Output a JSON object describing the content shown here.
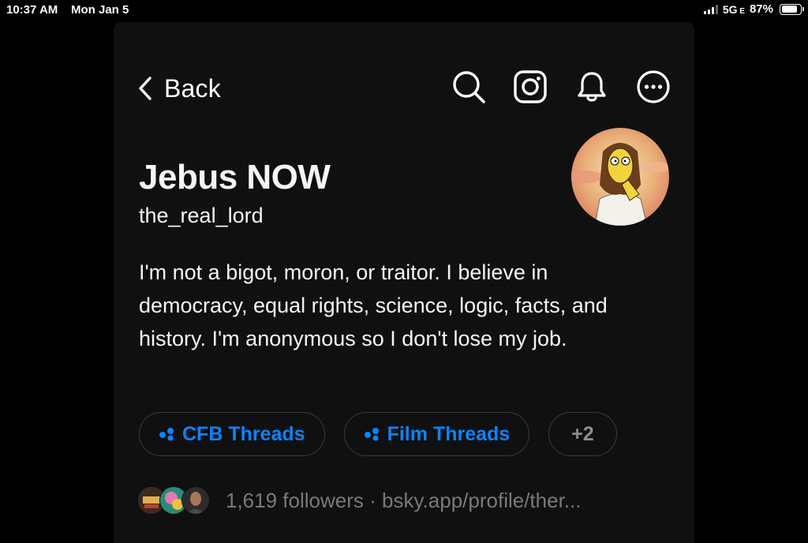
{
  "status_bar": {
    "time": "10:37 AM",
    "date": "Mon Jan 5",
    "network": "5G",
    "network_sub": "E",
    "battery": "87%",
    "battery_level": 0.87
  },
  "header": {
    "back_label": "Back",
    "icons": [
      "search-icon",
      "instagram-icon",
      "bell-icon",
      "more-icon"
    ]
  },
  "profile": {
    "name": "Jebus NOW",
    "handle": "the_real_lord",
    "bio": "I'm not a bigot, moron, or traitor. I believe in democracy, equal rights, science, logic, facts, and history. I'm anonymous so I don't lose my job."
  },
  "chips": [
    {
      "label": "CFB Threads",
      "icon": "threads-community-icon"
    },
    {
      "label": "Film Threads",
      "icon": "threads-community-icon"
    },
    {
      "label": "+2"
    }
  ],
  "followers": {
    "count_text": "1,619 followers",
    "separator": "·",
    "link_text": "bsky.app/profile/ther..."
  },
  "colors": {
    "background": "#000000",
    "panel": "#101010",
    "text": "#f3f5f7",
    "accent": "#0a84ff",
    "muted": "#77797c"
  }
}
